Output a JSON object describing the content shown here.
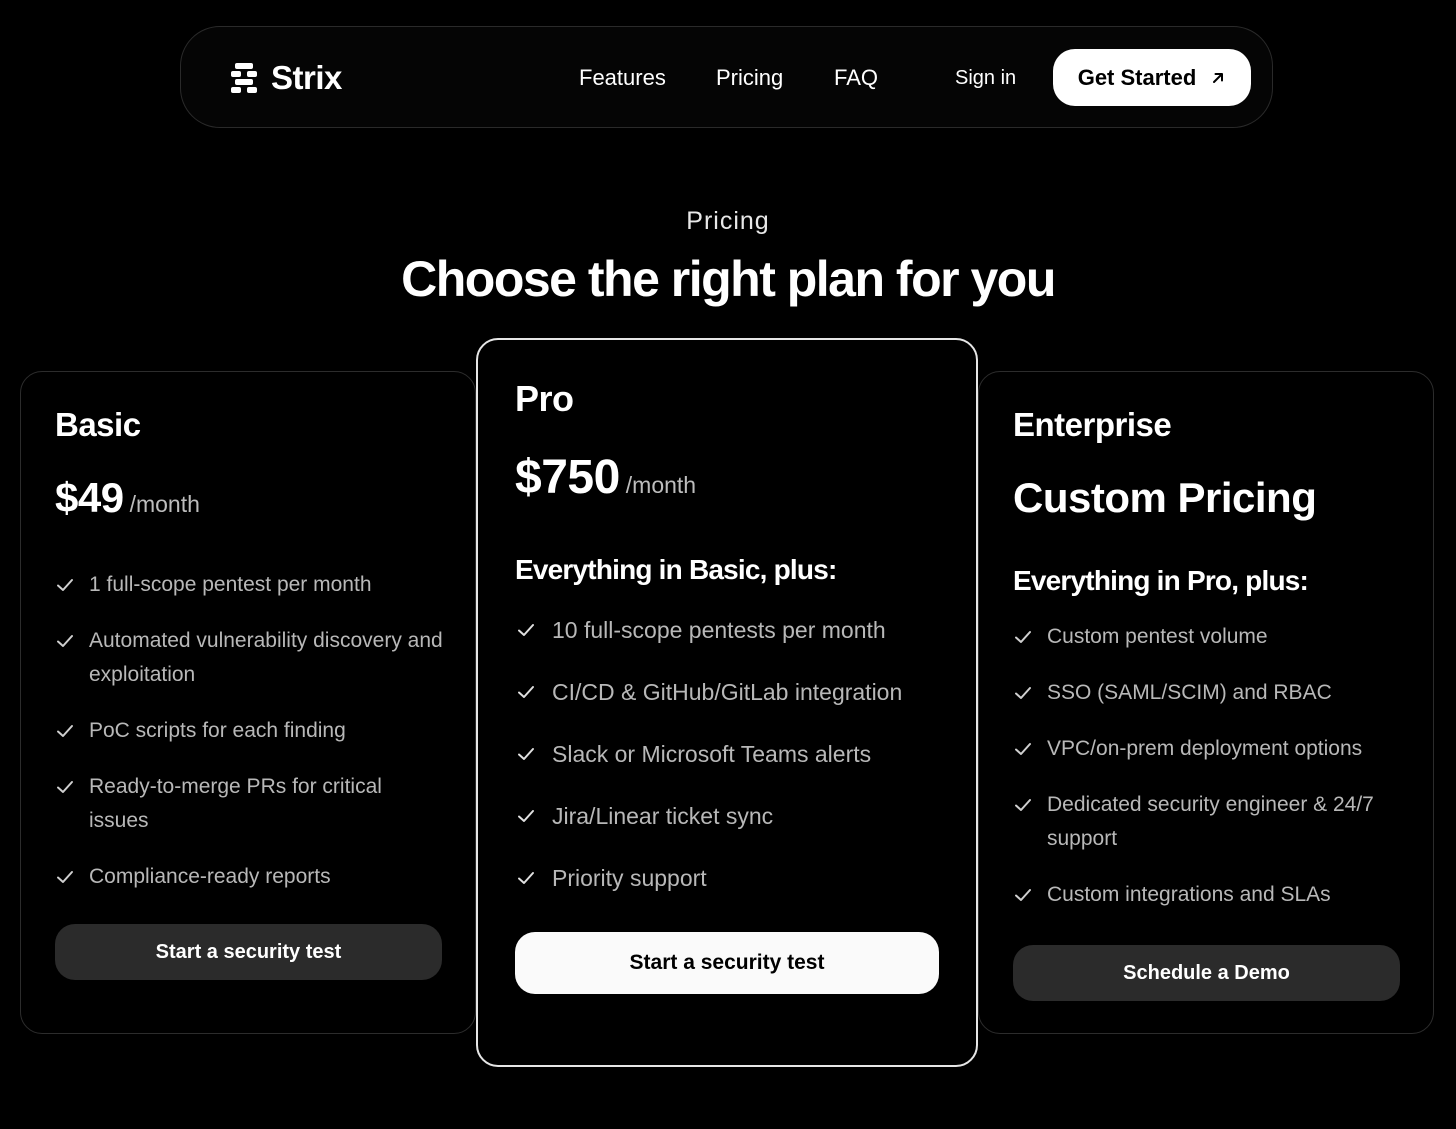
{
  "brand": {
    "name": "Strix"
  },
  "nav": {
    "links": [
      "Features",
      "Pricing",
      "FAQ"
    ],
    "signin": "Sign in",
    "cta": "Get Started"
  },
  "header": {
    "eyebrow": "Pricing",
    "title": "Choose the right plan for you"
  },
  "plans": {
    "basic": {
      "name": "Basic",
      "price": "$49",
      "period": "/month",
      "features": [
        "1 full-scope pentest per month",
        "Automated vulnerability discovery and exploitation",
        "PoC scripts for each finding",
        "Ready-to-merge PRs for critical issues",
        "Compliance-ready reports"
      ],
      "button": "Start a security test"
    },
    "pro": {
      "name": "Pro",
      "price": "$750",
      "period": "/month",
      "plus_title": "Everything in Basic, plus:",
      "features": [
        "10 full-scope pentests per month",
        "CI/CD & GitHub/GitLab integration",
        "Slack or Microsoft Teams alerts",
        "Jira/Linear ticket sync",
        "Priority support"
      ],
      "button": "Start a security test"
    },
    "enterprise": {
      "name": "Enterprise",
      "price_label": "Custom Pricing",
      "plus_title": "Everything in Pro, plus:",
      "features": [
        "Custom pentest volume",
        "SSO (SAML/SCIM) and RBAC",
        "VPC/on-prem deployment options",
        "Dedicated security engineer & 24/7 support",
        "Custom integrations and SLAs"
      ],
      "button": "Schedule a Demo"
    }
  },
  "colors": {
    "background": "#000000",
    "accent": "#ffffff",
    "muted_text": "#b8b8b8",
    "dark_button": "#2b2b2b"
  }
}
